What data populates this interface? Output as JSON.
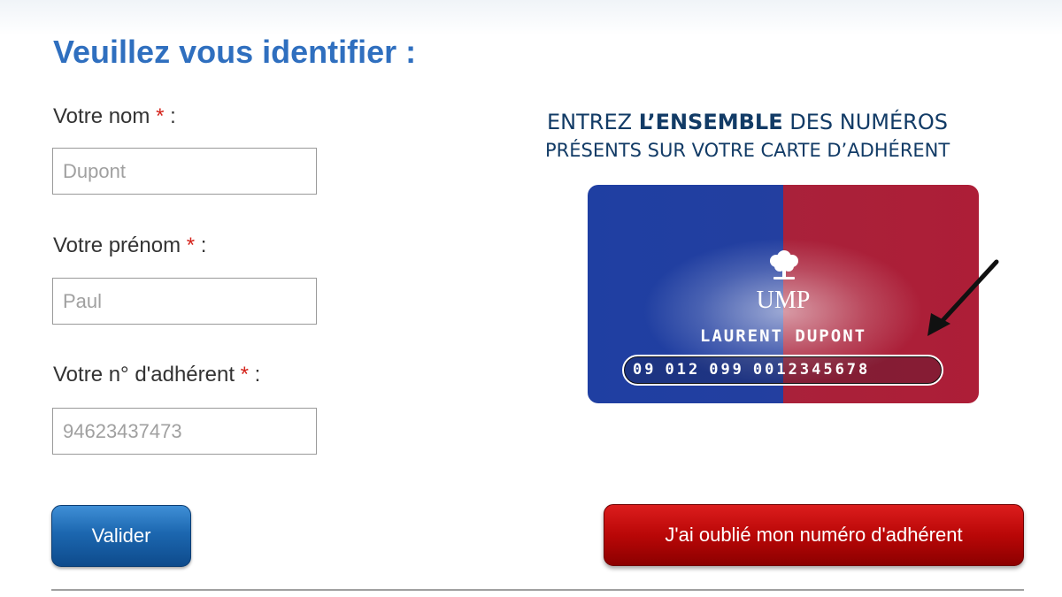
{
  "form": {
    "title": "Veuillez vous identifier :",
    "required_marker": "*",
    "fields": [
      {
        "label": "Votre nom",
        "suffix": " :",
        "placeholder": "Dupont"
      },
      {
        "label": "Votre prénom",
        "suffix": " :",
        "placeholder": "Paul"
      },
      {
        "label": "Votre n° d'adhérent",
        "suffix": " :",
        "placeholder": "94623437473"
      }
    ],
    "validate_label": "Valider",
    "forgot_label": "J'ai oublié mon numéro d'adhérent"
  },
  "instructions": {
    "line1_pre": "ENTREZ ",
    "line1_bold": "L’ENSEMBLE",
    "line1_post": " DES NUMÉROS",
    "line2": "PRÉSENTS SUR VOTRE CARTE D’ADHÉRENT"
  },
  "card": {
    "party": "UMP",
    "holder_name": "LAURENT DUPONT",
    "number_groups": [
      "09",
      "012",
      "099",
      "0012345678"
    ],
    "colors": {
      "blue": "#233fa0",
      "red": "#ad1e37"
    }
  },
  "colors": {
    "title": "#2f6fbf",
    "required": "#d4221a",
    "validate_button": "#1c67b0",
    "forgot_button": "#b90707"
  }
}
